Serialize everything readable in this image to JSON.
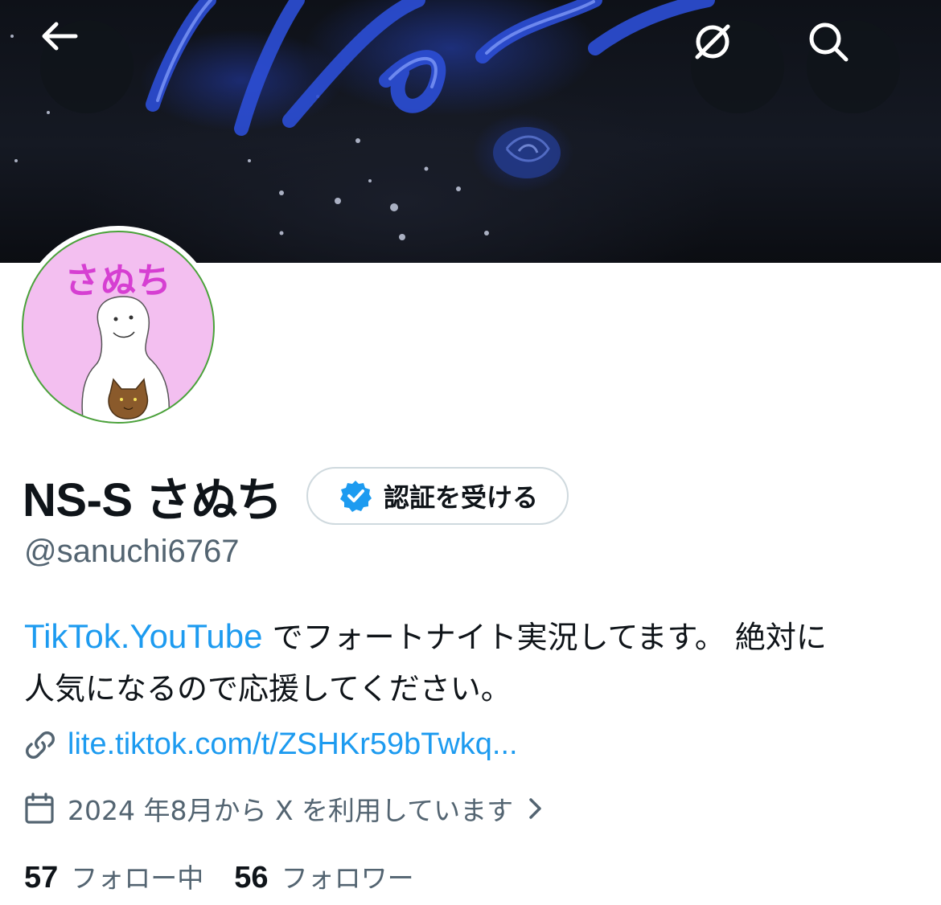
{
  "header": {
    "back_icon": "arrow-left-icon",
    "grok_icon": "grok-icon",
    "search_icon": "search-icon"
  },
  "banner": {
    "text": "No sleep"
  },
  "avatar": {
    "text": "さぬち"
  },
  "profile": {
    "display_name": "NS-S さぬち",
    "verify_label": "認証を受ける",
    "handle": "@sanuchi6767",
    "bio_link": "TikTok.YouTube",
    "bio_text_line1": " でフォートナイト実況してます。 絶対に",
    "bio_text_line2": "人気になるので応援してください。",
    "url": "lite.tiktok.com/t/ZSHKr59bTwkq...",
    "joined": "2024 年8月から X を利用しています"
  },
  "stats": {
    "following_count": "57",
    "following_label": "フォロー中",
    "followers_count": "56",
    "followers_label": "フォロワー"
  },
  "colors": {
    "accent": "#1d9bf0",
    "secondary_text": "#536471",
    "primary_text": "#0f1419",
    "avatar_bg": "#f3bff0",
    "avatar_text": "#d63fd2"
  }
}
